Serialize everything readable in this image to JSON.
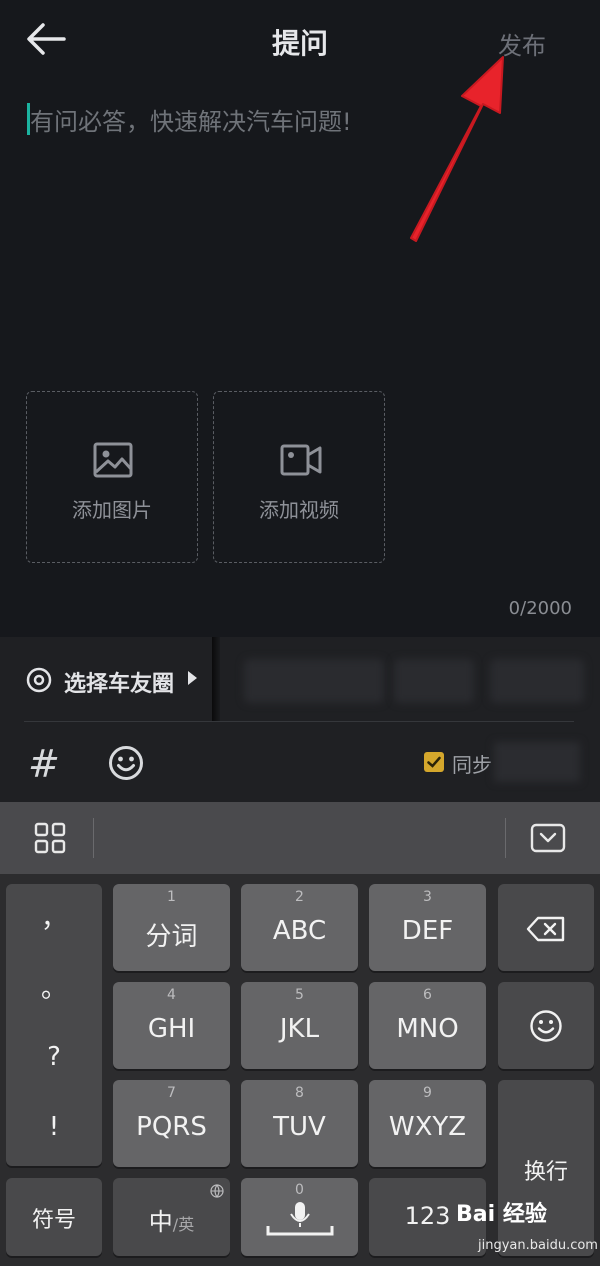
{
  "header": {
    "title": "提问",
    "publish_label": "发布"
  },
  "editor": {
    "placeholder": "有问必答，快速解决汽车问题!",
    "add_image_label": "添加图片",
    "add_video_label": "添加视频",
    "counter": "0/2000"
  },
  "toolbar": {
    "circle_label": "选择车友圈",
    "hash_symbol": "#",
    "sync_label": "同步"
  },
  "keyboard": {
    "punct_keys": [
      "，",
      "。",
      "?",
      "!"
    ],
    "keys": [
      {
        "num": "1",
        "label": "分词"
      },
      {
        "num": "2",
        "label": "ABC"
      },
      {
        "num": "3",
        "label": "DEF"
      },
      {
        "num": "4",
        "label": "GHI"
      },
      {
        "num": "5",
        "label": "JKL"
      },
      {
        "num": "6",
        "label": "MNO"
      },
      {
        "num": "7",
        "label": "PQRS"
      },
      {
        "num": "8",
        "label": "TUV"
      },
      {
        "num": "9",
        "label": "WXYZ"
      }
    ],
    "symbol_label": "符号",
    "lang_main": "中",
    "lang_sub": "/英",
    "space_num": "0",
    "num_label": "123",
    "enter_label": "换行"
  },
  "watermark": {
    "brand": "Bai 经验",
    "url": "jingyan.baidu.com"
  },
  "colors": {
    "background": "#16181c",
    "accent_cursor": "#1bb3a0",
    "checkbox": "#d4a72c",
    "annotation_arrow": "#e8232b"
  }
}
